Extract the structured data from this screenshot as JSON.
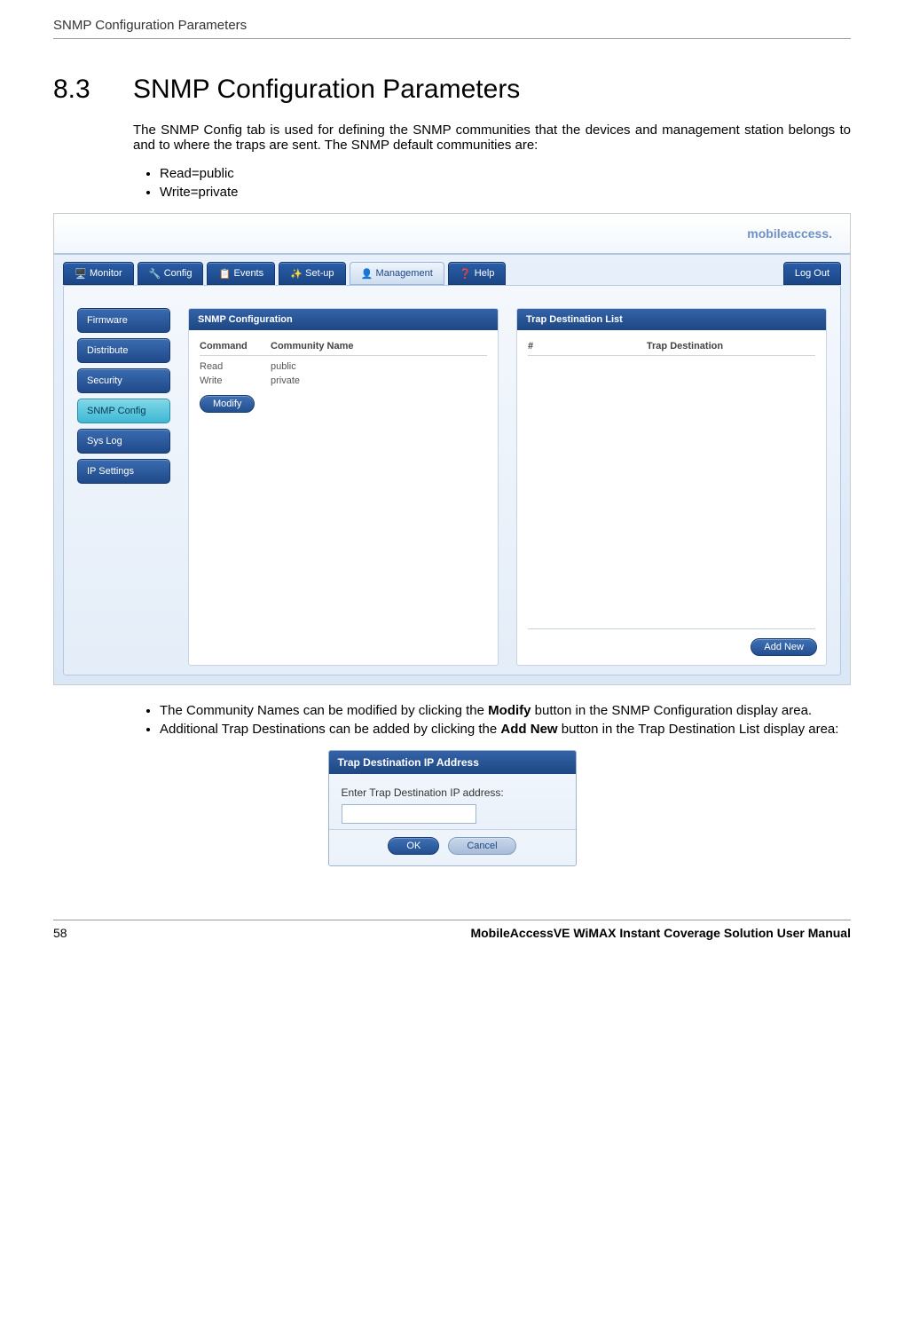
{
  "doc": {
    "header_title": "SNMP Configuration Parameters",
    "section_number": "8.3",
    "section_title": "SNMP Configuration Parameters",
    "intro": "The SNMP Config tab is used for defining the SNMP communities that the devices and management station belongs to and to where the traps are sent. The SNMP default communities are:",
    "bullet_read": "Read=public",
    "bullet_write": "Write=private",
    "note1_pre": "The Community Names can be modified by clicking the ",
    "note1_bold": "Modify",
    "note1_post": " button in the SNMP Configuration display area.",
    "note2_pre": "Additional Trap Destinations can be added by clicking the ",
    "note2_bold": "Add New",
    "note2_post": " button in the Trap Destination List display area:",
    "footer_page": "58",
    "footer_text": "MobileAccessVE WiMAX Instant Coverage Solution User Manual"
  },
  "app": {
    "logo": "mobileaccess.",
    "tabs": {
      "monitor": "Monitor",
      "config": "Config",
      "events": "Events",
      "setup": "Set-up",
      "management": "Management",
      "help": "Help",
      "logout": "Log Out"
    },
    "sidebar": {
      "firmware": "Firmware",
      "distribute": "Distribute",
      "security": "Security",
      "snmp": "SNMP Config",
      "syslog": "Sys Log",
      "ip": "IP Settings"
    },
    "snmp_panel": {
      "title": "SNMP Configuration",
      "hdr_command": "Command",
      "hdr_community": "Community Name",
      "rows": [
        {
          "cmd": "Read",
          "name": "public"
        },
        {
          "cmd": "Write",
          "name": "private"
        }
      ],
      "modify": "Modify"
    },
    "trap_panel": {
      "title": "Trap Destination List",
      "hdr_num": "#",
      "hdr_dest": "Trap Destination",
      "add_new": "Add New"
    }
  },
  "dialog": {
    "title": "Trap Destination IP Address",
    "label": "Enter Trap Destination IP address:",
    "input_value": "",
    "ok": "OK",
    "cancel": "Cancel"
  }
}
